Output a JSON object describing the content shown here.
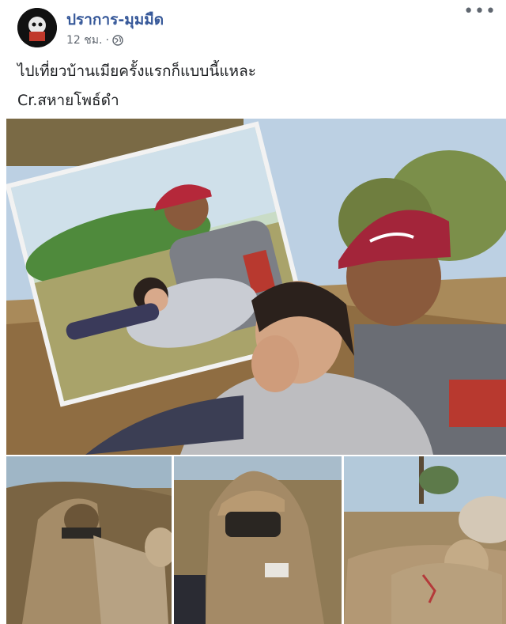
{
  "post": {
    "author": "ปราการ-มุมมืด",
    "time": "12 ชม.",
    "separator": "·",
    "privacy_icon": "globe-icon",
    "more_icon": "more-options-icon",
    "more_label": "•••",
    "lines": [
      "ไปเที่ยวบ้านเมียครั้งแรกก็แบบนี้แหละ",
      "Cr.สหายโพธ์ดำ"
    ]
  },
  "images": {
    "main": "couple-selfie-photo",
    "thumbs": [
      "hooded-person-thumb-1",
      "hooded-person-thumb-2",
      "hooded-person-thumb-3"
    ]
  },
  "colors": {
    "link": "#365899",
    "meta": "#606770",
    "cap": "#a3253a",
    "sky": "#b9cde0"
  }
}
